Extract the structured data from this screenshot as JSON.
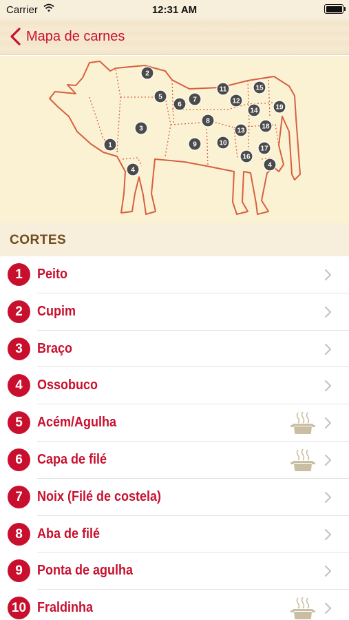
{
  "status": {
    "carrier": "Carrier",
    "time": "12:31 AM"
  },
  "nav": {
    "back_label": "Mapa de carnes"
  },
  "section": {
    "title": "CORTES"
  },
  "colors": {
    "accent": "#c8102e",
    "header_text": "#6f4d1c",
    "map_bg": "#fbf2d4",
    "marker": "#4a4a4a"
  },
  "map_labels": [
    "1",
    "2",
    "3",
    "4",
    "5",
    "6",
    "7",
    "8",
    "9",
    "10",
    "11",
    "12",
    "13",
    "14",
    "15",
    "16",
    "17",
    "18",
    "19"
  ],
  "cuts": [
    {
      "num": "1",
      "name": "Peito",
      "pot": false
    },
    {
      "num": "2",
      "name": "Cupim",
      "pot": false
    },
    {
      "num": "3",
      "name": "Braço",
      "pot": false
    },
    {
      "num": "4",
      "name": "Ossobuco",
      "pot": false
    },
    {
      "num": "5",
      "name": "Acém/Agulha",
      "pot": true
    },
    {
      "num": "6",
      "name": "Capa de filé",
      "pot": true
    },
    {
      "num": "7",
      "name": "Noix (Filé de costela)",
      "pot": false
    },
    {
      "num": "8",
      "name": "Aba de filé",
      "pot": false
    },
    {
      "num": "9",
      "name": "Ponta de agulha",
      "pot": false
    },
    {
      "num": "10",
      "name": "Fraldinha",
      "pot": true
    }
  ]
}
